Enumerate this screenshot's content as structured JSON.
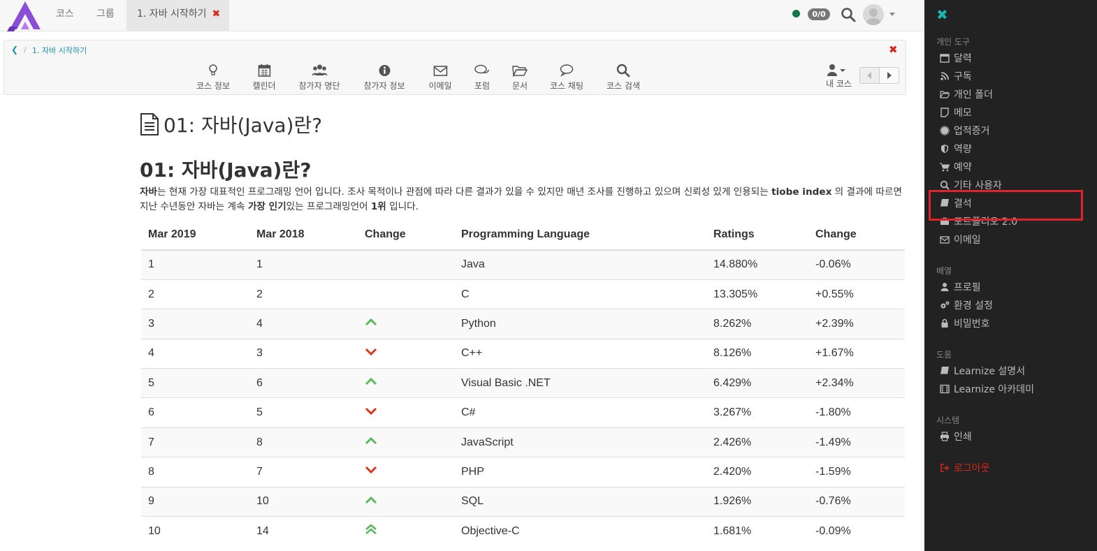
{
  "topnav": {
    "items": [
      "코스",
      "그룹"
    ],
    "active_tab": "1. 자바 시작하기",
    "badge": "0/0"
  },
  "toolbar": {
    "breadcrumb_current": "1. 자바 시작하기",
    "tools": [
      "코스 정보",
      "캘린더",
      "참가자 명단",
      "참가자 정보",
      "이메일",
      "포럼",
      "문서",
      "코스 채팅",
      "코스 검색"
    ],
    "my_course": "내 코스"
  },
  "content": {
    "page_title": "01: 자바(Java)란?",
    "section_title": "01: 자바(Java)란?",
    "intro": {
      "p1": "자바",
      "p2": "는 현재 가장 대표적인 프로그래밍 언어 입니다. 조사 목적이나 관점에 따라 다른 결과가 있을 수 있지만 매년 조사를 진행하고 있으며 신뢰성 있게 인용되는 ",
      "p3": "tiobe index",
      "p4": " 의 결과에 따르면 지난 수년동안 자바는 계속 ",
      "p5": "가장 인기",
      "p6": "있는 프로그래밍언어 ",
      "p7": "1위",
      "p8": " 입니다."
    },
    "table": {
      "headers": [
        "Mar 2019",
        "Mar 2018",
        "Change",
        "Programming Language",
        "Ratings",
        "Change"
      ],
      "rows": [
        {
          "c1": "1",
          "c2": "1",
          "trend": "none",
          "lang": "Java",
          "rating": "14.880%",
          "change": "-0.06%"
        },
        {
          "c1": "2",
          "c2": "2",
          "trend": "none",
          "lang": "C",
          "rating": "13.305%",
          "change": "+0.55%"
        },
        {
          "c1": "3",
          "c2": "4",
          "trend": "up",
          "lang": "Python",
          "rating": "8.262%",
          "change": "+2.39%"
        },
        {
          "c1": "4",
          "c2": "3",
          "trend": "down",
          "lang": "C++",
          "rating": "8.126%",
          "change": "+1.67%"
        },
        {
          "c1": "5",
          "c2": "6",
          "trend": "up",
          "lang": "Visual Basic .NET",
          "rating": "6.429%",
          "change": "+2.34%"
        },
        {
          "c1": "6",
          "c2": "5",
          "trend": "down",
          "lang": "C#",
          "rating": "3.267%",
          "change": "-1.80%"
        },
        {
          "c1": "7",
          "c2": "8",
          "trend": "up",
          "lang": "JavaScript",
          "rating": "2.426%",
          "change": "-1.49%"
        },
        {
          "c1": "8",
          "c2": "7",
          "trend": "down",
          "lang": "PHP",
          "rating": "2.420%",
          "change": "-1.59%"
        },
        {
          "c1": "9",
          "c2": "10",
          "trend": "up",
          "lang": "SQL",
          "rating": "1.926%",
          "change": "-0.76%"
        },
        {
          "c1": "10",
          "c2": "14",
          "trend": "double-up",
          "lang": "Objective-C",
          "rating": "1.681%",
          "change": "-0.09%"
        }
      ]
    }
  },
  "sidebar": {
    "personal_heading": "개인 도구",
    "personal": [
      {
        "label": "달력",
        "icon": "calendar-icon"
      },
      {
        "label": "구독",
        "icon": "rss-icon"
      },
      {
        "label": "개인 폴더",
        "icon": "folder-icon"
      },
      {
        "label": "메모",
        "icon": "note-icon"
      },
      {
        "label": "업적증거",
        "icon": "certificate-icon"
      },
      {
        "label": "역량",
        "icon": "shield-icon"
      },
      {
        "label": "예약",
        "icon": "cart-icon"
      },
      {
        "label": "기타 사용자",
        "icon": "search-icon"
      },
      {
        "label": "결석",
        "icon": "book-icon"
      },
      {
        "label": "포트폴리오 2.0",
        "icon": "portfolio-icon"
      },
      {
        "label": "이메일",
        "icon": "envelope-icon"
      }
    ],
    "config_heading": "배열",
    "config": [
      {
        "label": "프로필",
        "icon": "user-icon"
      },
      {
        "label": "환경 설정",
        "icon": "gears-icon"
      },
      {
        "label": "비밀번호",
        "icon": "lock-icon"
      }
    ],
    "help_heading": "도움",
    "help": [
      {
        "label": "Learnize 설명서",
        "icon": "book-icon"
      },
      {
        "label": "Learnize 아카데미",
        "icon": "film-icon"
      }
    ],
    "system_heading": "시스템",
    "system": [
      {
        "label": "인쇄",
        "icon": "print-icon"
      }
    ],
    "logout": "로그아웃",
    "colors": {
      "background": "#222222",
      "accent": "#1ab4ab",
      "logout": "#d9261c",
      "highlight": "#e0222b"
    }
  }
}
